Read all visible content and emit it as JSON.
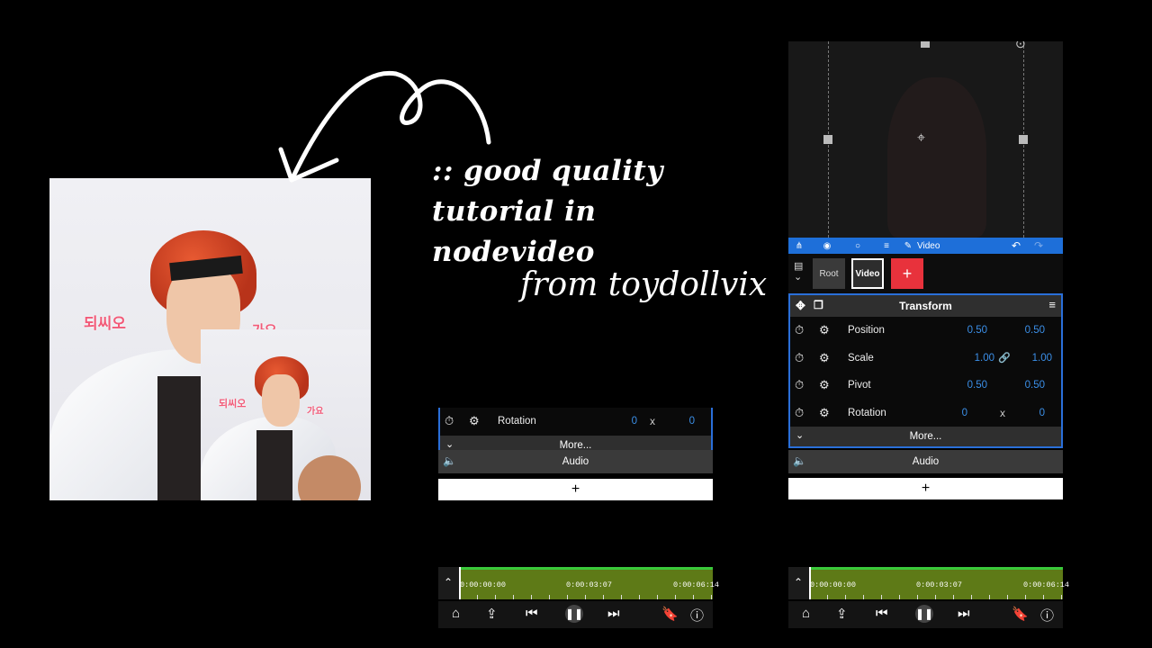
{
  "photo": {
    "overlay_text_left": "되씨오",
    "overlay_text_right": "가요",
    "inset_text_left": "되씨오",
    "inset_text_right": "가요"
  },
  "caption": {
    "line1": ":: good quality",
    "line2": "tutorial in",
    "line3": "nodevideo",
    "signature": "from toydollvix"
  },
  "editor": {
    "toolbar": {
      "mode_label": "Video"
    },
    "nodes": {
      "root_label": "Root",
      "video_label": "Video",
      "add_label": "+"
    },
    "transform": {
      "title": "Transform",
      "properties": [
        {
          "name": "Position",
          "value1": "0.50",
          "middle": "",
          "value2": "0.50"
        },
        {
          "name": "Scale",
          "value1": "1.00",
          "middle": "🔗",
          "value2": "1.00"
        },
        {
          "name": "Pivot",
          "value1": "0.50",
          "middle": "",
          "value2": "0.50"
        },
        {
          "name": "Rotation",
          "value1": "0",
          "middle": "x",
          "value2": "0"
        }
      ],
      "more_label": "More..."
    },
    "audio_label": "Audio",
    "add_row_label": "+",
    "timeline": {
      "start": "0:00:00:00",
      "current": "0:00:03:07",
      "end": "0:00:06:14"
    }
  },
  "icons": {
    "colors": {
      "accent": "#1e6fd9",
      "add_node": "#e8323c",
      "track": "#5e7a17",
      "track_edge": "#39c83a",
      "value": "#3b8fe8"
    }
  }
}
